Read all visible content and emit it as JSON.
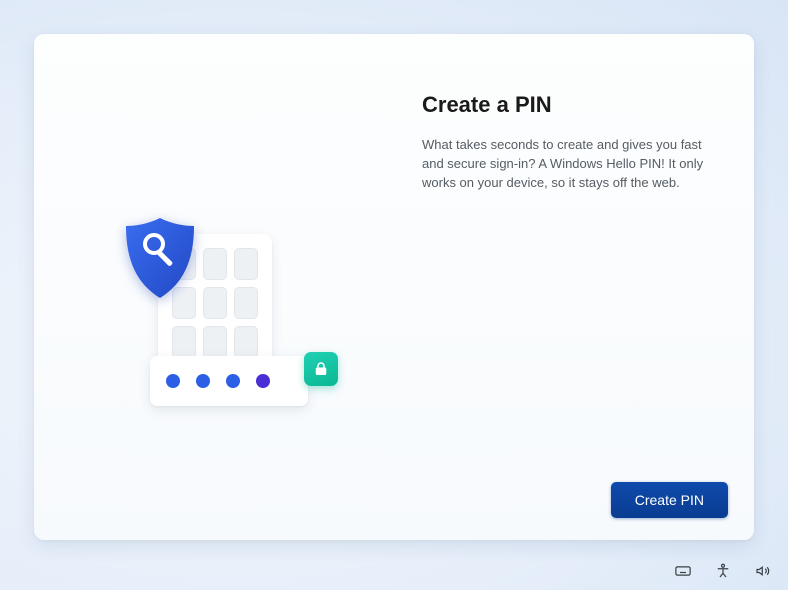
{
  "heading": "Create a PIN",
  "body": "What takes seconds to create and gives you fast and secure sign-in? A Windows Hello PIN! It only works on your device, so it stays off the web.",
  "cta_label": "Create PIN",
  "illustration": {
    "dot_colors": [
      "#2c5fe6",
      "#2c5fe6",
      "#2c5fe6",
      "#4b2fd6"
    ],
    "shield_color": "#2b5fe6",
    "shield_color_dark": "#2148c4",
    "badge_color": "#10c4a0"
  },
  "tray": {
    "keyboard_icon": "keyboard-icon",
    "accessibility_icon": "accessibility-icon",
    "volume_icon": "volume-icon"
  }
}
